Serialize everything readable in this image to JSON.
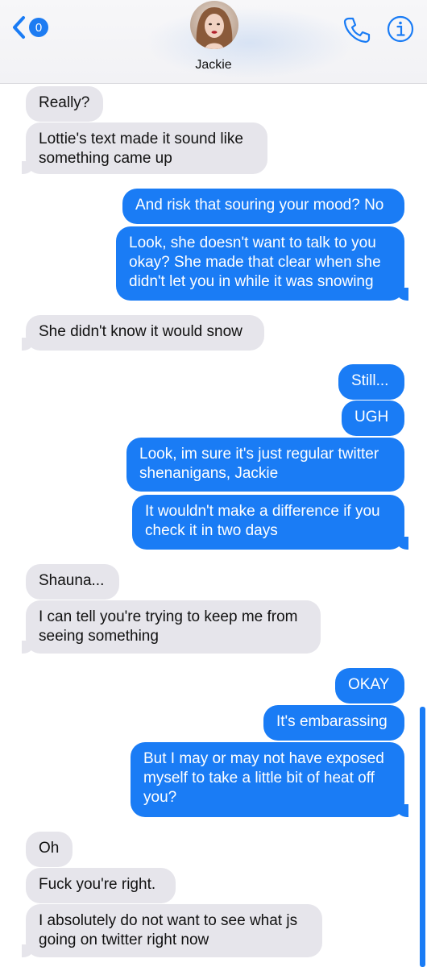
{
  "header": {
    "back_badge": "0",
    "contact_name": "Jackie",
    "icons": {
      "back": "chevron-left-icon",
      "call": "phone-icon",
      "info": "info-icon"
    },
    "accent_color": "#1a7cf5"
  },
  "messages": [
    {
      "sender": "contact",
      "text": "Really?"
    },
    {
      "sender": "contact",
      "lines": [
        "Lottie's text made it sound like",
        "something came up"
      ]
    },
    {
      "sender": "me",
      "text": "And risk that souring your mood? No"
    },
    {
      "sender": "me",
      "lines": [
        "Look, she doesn't want to talk to you",
        "okay? She made that clear when she",
        "didn't let you in while it was snowing"
      ]
    },
    {
      "sender": "contact",
      "text": "She didn't know it would snow"
    },
    {
      "sender": "me",
      "text": "Still..."
    },
    {
      "sender": "me",
      "text": "UGH"
    },
    {
      "sender": "me",
      "lines": [
        "Look, im sure it's just regular twitter",
        "shenanigans, Jackie"
      ]
    },
    {
      "sender": "me",
      "lines": [
        "It wouldn't make a difference if you",
        "check it in two days"
      ]
    },
    {
      "sender": "contact",
      "text": "Shauna..."
    },
    {
      "sender": "contact",
      "lines": [
        "I can tell you're trying to keep me from",
        "seeing something"
      ]
    },
    {
      "sender": "me",
      "text": "OKAY"
    },
    {
      "sender": "me",
      "text": "It's embarassing"
    },
    {
      "sender": "me",
      "lines": [
        "But I may or may not have exposed",
        "myself to take a little bit of heat off",
        "you?"
      ]
    },
    {
      "sender": "contact",
      "text": "Oh"
    },
    {
      "sender": "contact",
      "text": "Fuck you're right."
    },
    {
      "sender": "contact",
      "lines": [
        "I absolutely do not want to see what js",
        "going on twitter right now"
      ]
    }
  ]
}
